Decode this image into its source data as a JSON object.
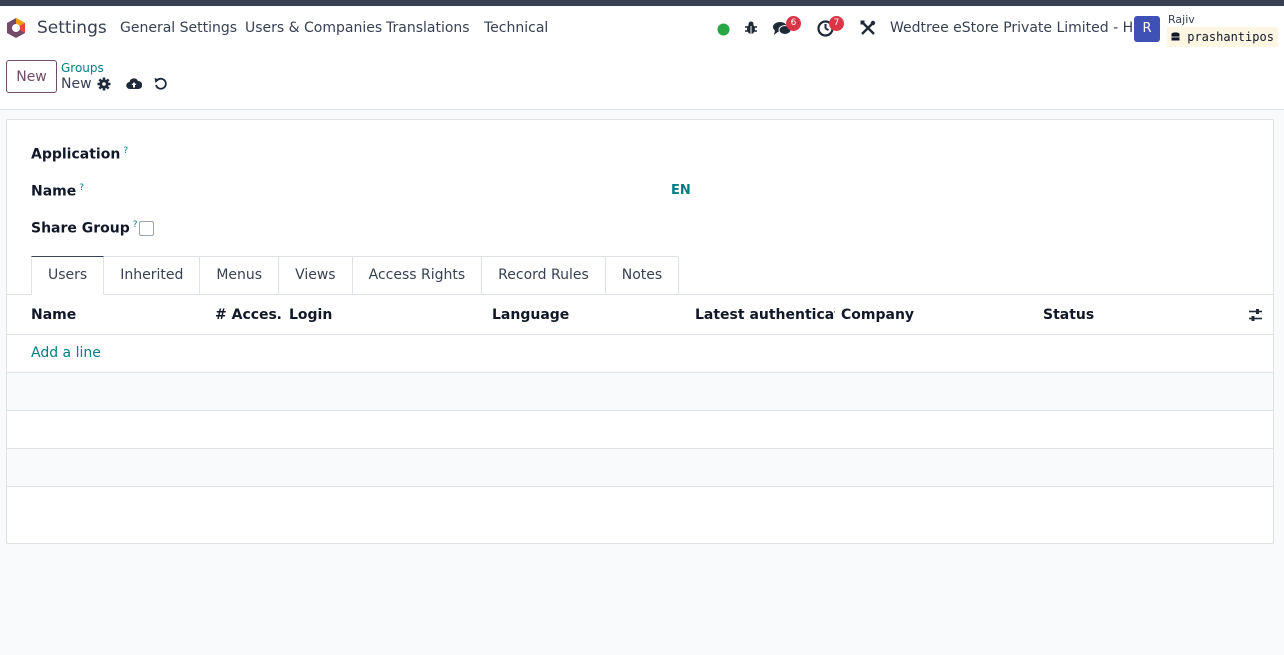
{
  "navbar": {
    "app_name": "Settings",
    "menus": [
      "General Settings",
      "Users & Companies",
      "Translations",
      "Technical"
    ],
    "messages_badge": "6",
    "activities_badge": "7",
    "company": "Wedtree eStore Private Limited - HO",
    "user_initial": "R",
    "user_name": "Rajiv",
    "database": "prashantipos",
    "status_color": "#28a745"
  },
  "control": {
    "new_label": "New",
    "breadcrumb": "Groups",
    "record_name": "New"
  },
  "form": {
    "application_label": "Application",
    "name_label": "Name",
    "share_group_label": "Share Group",
    "tooltip_mark": "?",
    "lang_code": "EN"
  },
  "tabs": [
    "Users",
    "Inherited",
    "Menus",
    "Views",
    "Access Rights",
    "Record Rules",
    "Notes"
  ],
  "table": {
    "columns": [
      "Name",
      "# Acces…",
      "Login",
      "Language",
      "Latest authenticati…",
      "Company",
      "Status"
    ],
    "add_line": "Add a line"
  },
  "colors": {
    "primary": "#714b67",
    "link": "#017e84",
    "badge": "#dc3545",
    "avatar": "#3f51b5"
  }
}
